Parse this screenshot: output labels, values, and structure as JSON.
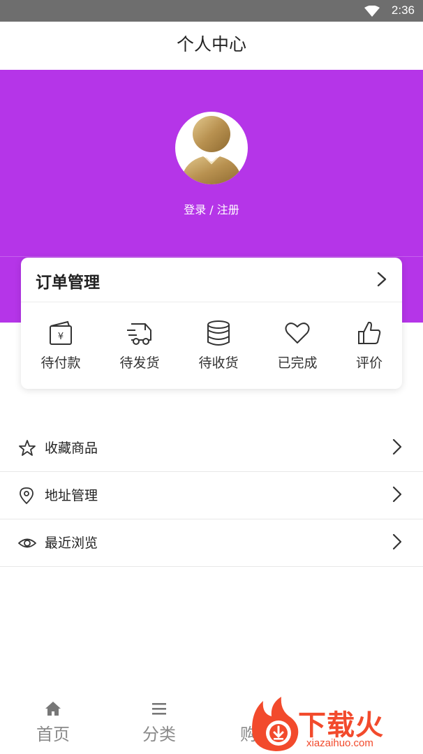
{
  "status_bar": {
    "time": "2:36"
  },
  "header": {
    "title": "个人中心"
  },
  "profile": {
    "login_label": "登录 / 注册"
  },
  "orders": {
    "title": "订单管理",
    "items": [
      {
        "label": "待付款",
        "icon": "wallet-icon"
      },
      {
        "label": "待发货",
        "icon": "truck-icon"
      },
      {
        "label": "待收货",
        "icon": "coins-icon"
      },
      {
        "label": "已完成",
        "icon": "heart-icon"
      },
      {
        "label": "评价",
        "icon": "thumbs-up-icon"
      }
    ]
  },
  "menu": [
    {
      "label": "收藏商品",
      "icon": "star-icon"
    },
    {
      "label": "地址管理",
      "icon": "location-pin-icon"
    },
    {
      "label": "最近浏览",
      "icon": "eye-icon"
    }
  ],
  "tabbar": {
    "items": [
      {
        "label": "首页",
        "icon": "home-icon"
      },
      {
        "label": "分类",
        "icon": "menu-icon"
      },
      {
        "label": "购",
        "icon": "cart-icon"
      }
    ]
  },
  "watermark": {
    "text": "下载火",
    "url": "xiazaihuo.com"
  },
  "colors": {
    "accent": "#b535e8",
    "watermark": "#f24a2c"
  }
}
